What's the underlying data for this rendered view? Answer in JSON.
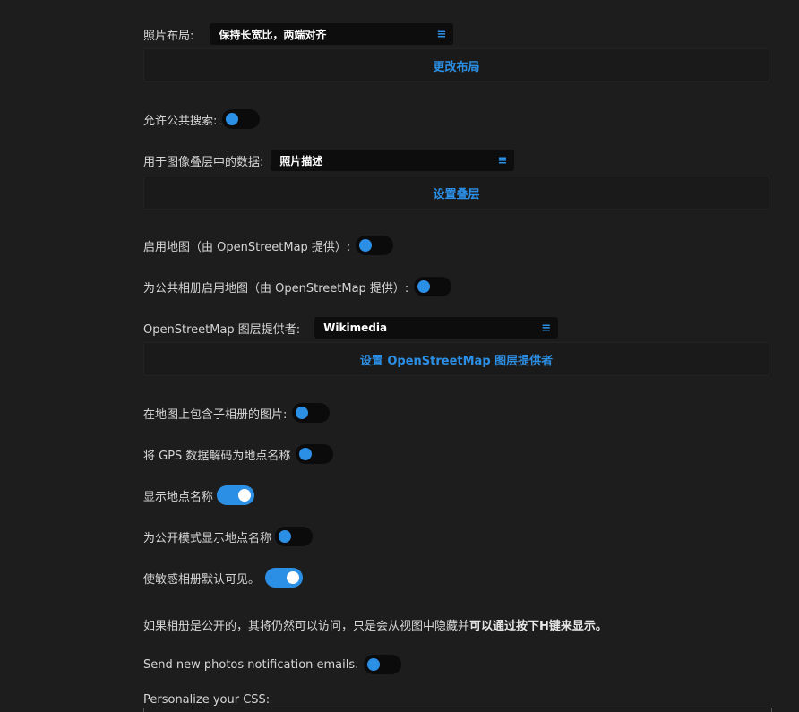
{
  "settings": {
    "photo_layout": {
      "label": "照片布局:",
      "value": "保持长宽比，两端对齐",
      "button": "更改布局"
    },
    "public_search": {
      "label": "允许公共搜索:",
      "enabled": false
    },
    "overlay": {
      "label": "用于图像叠层中的数据:",
      "value": "照片描述",
      "button": "设置叠层"
    },
    "map_enabled": {
      "label": "启用地图（由 OpenStreetMap 提供）:",
      "enabled": false
    },
    "map_public": {
      "label": "为公共相册启用地图（由 OpenStreetMap 提供）:",
      "enabled": false
    },
    "osm_provider": {
      "label": "OpenStreetMap 图层提供者:",
      "value": "Wikimedia",
      "button": "设置 OpenStreetMap 图层提供者"
    },
    "map_include_subalbums": {
      "label": "在地图上包含子相册的图片:",
      "enabled": false
    },
    "gps_decode": {
      "label": "将 GPS 数据解码为地点名称",
      "enabled": false
    },
    "show_location": {
      "label": "显示地点名称",
      "enabled": true
    },
    "public_location": {
      "label": "为公开模式显示地点名称",
      "enabled": false
    },
    "sensitive_visible": {
      "label": "使敏感相册默认可见。",
      "enabled": true
    },
    "info": {
      "text": "如果相册是公开的，其将仍然可以访问，只是会从视图中隐藏并",
      "bold": "可以通过按下H键来显示。"
    },
    "new_photos_email": {
      "label": "Send new photos notification emails.",
      "enabled": false
    },
    "custom_css": {
      "label": "Personalize your CSS:"
    }
  },
  "icons": {
    "select_menu": "menu-lines-icon"
  },
  "colors": {
    "accent": "#2c8fe6",
    "background": "#1d1d1d",
    "control_bg": "#0d0d0d"
  }
}
